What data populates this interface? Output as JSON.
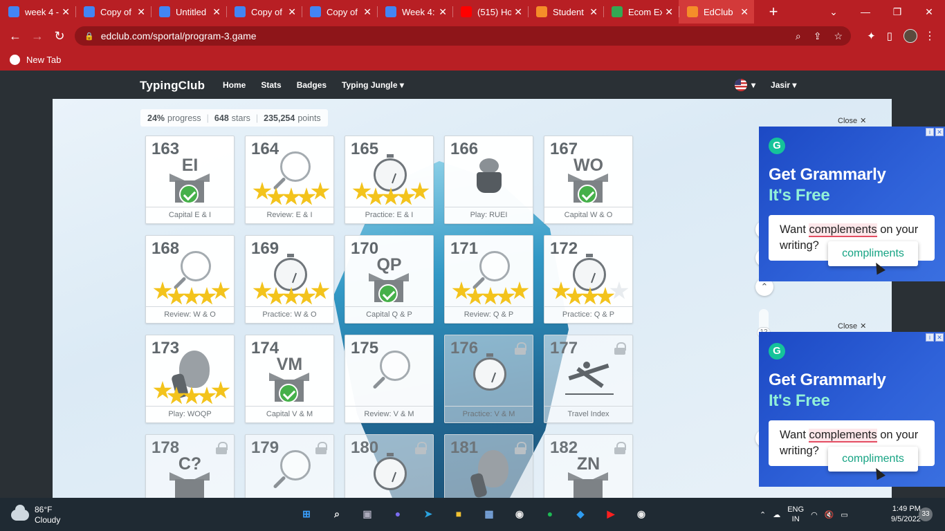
{
  "browser": {
    "tabs": [
      {
        "title": "week 4 -",
        "color": "#4285f4"
      },
      {
        "title": "Copy of",
        "color": "#4285f4"
      },
      {
        "title": "Untitled",
        "color": "#4285f4"
      },
      {
        "title": "Copy of",
        "color": "#4285f4"
      },
      {
        "title": "Copy of",
        "color": "#4285f4"
      },
      {
        "title": "Week 4:",
        "color": "#4285f4"
      },
      {
        "title": "(515) Ho",
        "color": "#ff0000"
      },
      {
        "title": "Student",
        "color": "#f58d29"
      },
      {
        "title": "Ecom Ex",
        "color": "#34a853"
      },
      {
        "title": "EdClub",
        "color": "#f58d29"
      }
    ],
    "url": "edclub.com/sportal/program-3.game",
    "bookmark": "New Tab",
    "theme_color": "#b81f24"
  },
  "site": {
    "logo": "TypingClub",
    "menu": [
      "Home",
      "Stats",
      "Badges",
      "Typing Jungle"
    ],
    "user": "Jasir",
    "progress": {
      "percent": "24%",
      "percent_label": "progress",
      "stars": "648",
      "stars_label": "stars",
      "points": "235,254",
      "points_label": "points"
    }
  },
  "lessons": [
    {
      "num": "163",
      "label": "Capital E & I",
      "type": "capital",
      "letters": "EI",
      "done": true
    },
    {
      "num": "164",
      "label": "Review: E & I",
      "type": "review",
      "stars": 5
    },
    {
      "num": "165",
      "label": "Practice: E & I",
      "type": "practice",
      "stars": 5
    },
    {
      "num": "166",
      "label": "Play: RUEI",
      "type": "play"
    },
    {
      "num": "167",
      "label": "Capital W & O",
      "type": "capital",
      "letters": "WO",
      "done": true
    },
    {
      "num": "168",
      "label": "Review: W & O",
      "type": "review",
      "stars": 5
    },
    {
      "num": "169",
      "label": "Practice: W & O",
      "type": "practice",
      "stars": 5
    },
    {
      "num": "170",
      "label": "Capital Q & P",
      "type": "capital",
      "letters": "QP",
      "done": true
    },
    {
      "num": "171",
      "label": "Review: Q & P",
      "type": "review",
      "stars": 5
    },
    {
      "num": "172",
      "label": "Practice: Q & P",
      "type": "practice",
      "stars": 4
    },
    {
      "num": "173",
      "label": "Play: WOQP",
      "type": "boulder",
      "stars": 5
    },
    {
      "num": "174",
      "label": "Capital V & M",
      "type": "capital",
      "letters": "VM",
      "done": true
    },
    {
      "num": "175",
      "label": "Review: V & M",
      "type": "review"
    },
    {
      "num": "176",
      "label": "Practice: V & M",
      "type": "practice",
      "locked": true,
      "dimmed": true
    },
    {
      "num": "177",
      "label": "Travel Index",
      "type": "yoga",
      "locked": true
    },
    {
      "num": "178",
      "label": "",
      "type": "capital",
      "letters": "C?",
      "locked": true
    },
    {
      "num": "179",
      "label": "",
      "type": "review",
      "locked": true
    },
    {
      "num": "180",
      "label": "",
      "type": "practice",
      "locked": true
    },
    {
      "num": "181",
      "label": "",
      "type": "boulder",
      "locked": true,
      "dimmed": true
    },
    {
      "num": "182",
      "label": "",
      "type": "capital",
      "letters": "ZN",
      "locked": true
    }
  ],
  "scroll_page": "12",
  "ads": [
    {
      "close": "Close",
      "headline1": "Get Grammarly",
      "headline2": "It's Free",
      "text_before": "Want ",
      "error_word": "complements",
      "text_after": " on your writing?",
      "suggestion": "compliments"
    },
    {
      "close": "Close",
      "headline1": "Get Grammarly",
      "headline2": "It's Free",
      "text_before": "Want ",
      "error_word": "complements",
      "text_after": " on your writing?",
      "suggestion": "compliments"
    }
  ],
  "taskbar": {
    "weather_temp": "86°F",
    "weather_desc": "Cloudy",
    "lang1": "ENG",
    "lang2": "IN",
    "time": "1:49 PM",
    "date": "9/5/2022",
    "notifications": "33"
  }
}
